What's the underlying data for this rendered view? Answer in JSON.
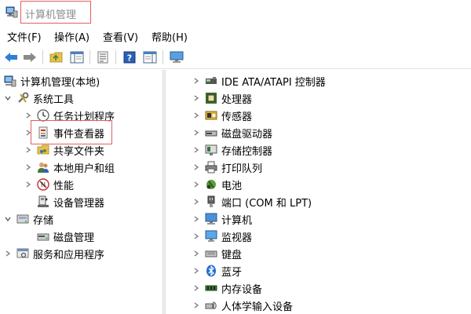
{
  "window": {
    "title": "计算机管理"
  },
  "menu": [
    "文件(F)",
    "操作(A)",
    "查看(V)",
    "帮助(H)"
  ],
  "toolbar": [
    "back-icon",
    "forward-icon",
    "up-folder-icon",
    "show-tree-icon",
    "properties-icon",
    "help-icon",
    "console-tree-icon",
    "monitor-icon"
  ],
  "tree": {
    "root": "计算机管理(本地)",
    "system_tools": "系统工具",
    "task_scheduler": "任务计划程序",
    "event_viewer": "事件查看器",
    "shared_folders": "共享文件夹",
    "local_users": "本地用户和组",
    "performance": "性能",
    "device_manager": "设备管理器",
    "storage": "存储",
    "disk_management": "磁盘管理",
    "services_apps": "服务和应用程序"
  },
  "devices": [
    {
      "label": "IDE ATA/ATAPI 控制器",
      "icon": "ide-controller-icon"
    },
    {
      "label": "处理器",
      "icon": "processor-icon"
    },
    {
      "label": "传感器",
      "icon": "sensor-icon"
    },
    {
      "label": "磁盘驱动器",
      "icon": "disk-drive-icon"
    },
    {
      "label": "存储控制器",
      "icon": "storage-controller-icon"
    },
    {
      "label": "打印队列",
      "icon": "printer-icon"
    },
    {
      "label": "电池",
      "icon": "battery-icon"
    },
    {
      "label": "端口 (COM 和 LPT)",
      "icon": "port-icon"
    },
    {
      "label": "计算机",
      "icon": "computer-icon"
    },
    {
      "label": "监视器",
      "icon": "monitor-icon"
    },
    {
      "label": "键盘",
      "icon": "keyboard-icon"
    },
    {
      "label": "蓝牙",
      "icon": "bluetooth-icon"
    },
    {
      "label": "内存设备",
      "icon": "memory-icon"
    },
    {
      "label": "人体学输入设备",
      "icon": "hid-icon"
    }
  ],
  "colors": {
    "highlight_border": "#e06060",
    "title_text": "#8c8c8c"
  }
}
